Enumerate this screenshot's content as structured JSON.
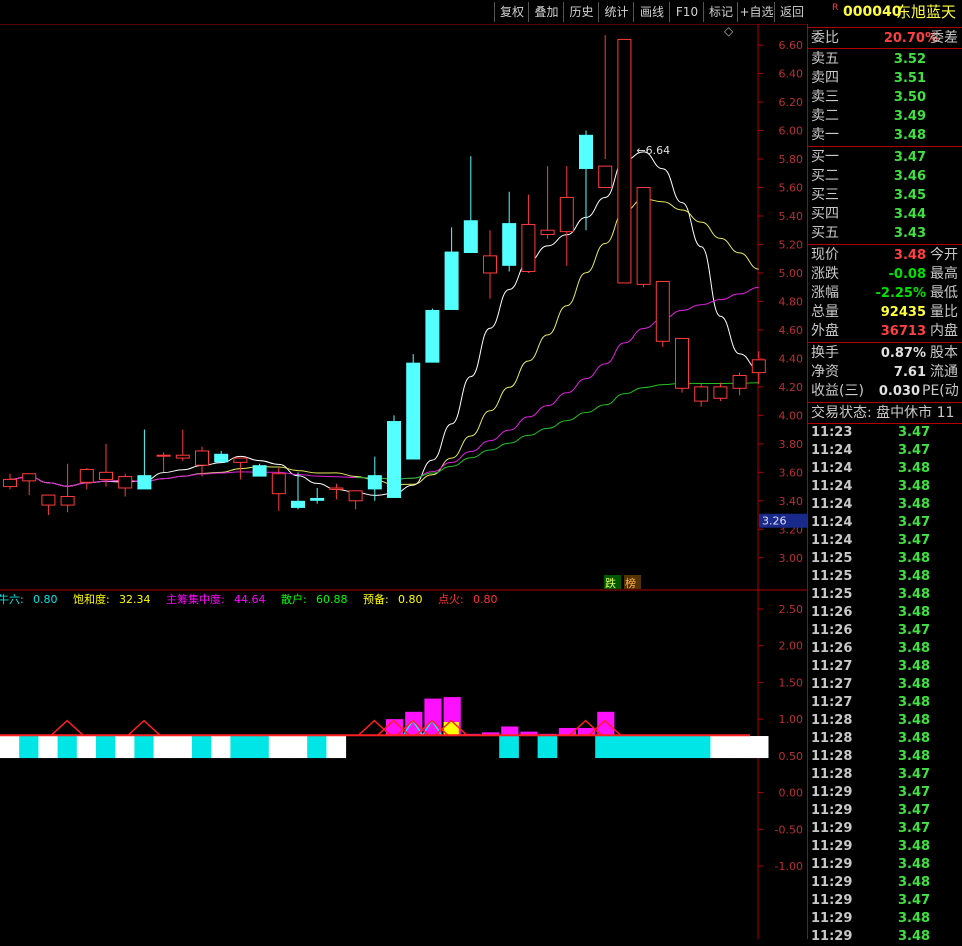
{
  "toolbar": {
    "buttons": [
      "复权",
      "叠加",
      "历史",
      "统计",
      "画线",
      "F10",
      "标记",
      "+自选",
      "返回"
    ],
    "diamond_icon": "diamond-icon"
  },
  "stock": {
    "badge": "R",
    "code": "000040",
    "name": "东旭蓝天"
  },
  "quote": {
    "weibi_label": "委比",
    "weibi_value": "20.70%",
    "weicha_label": "委差",
    "asks": [
      {
        "label": "卖五",
        "price": "3.52"
      },
      {
        "label": "卖四",
        "price": "3.51"
      },
      {
        "label": "卖三",
        "price": "3.50"
      },
      {
        "label": "卖二",
        "price": "3.49"
      },
      {
        "label": "卖一",
        "price": "3.48"
      }
    ],
    "bids": [
      {
        "label": "买一",
        "price": "3.47"
      },
      {
        "label": "买二",
        "price": "3.46"
      },
      {
        "label": "买三",
        "price": "3.45"
      },
      {
        "label": "买四",
        "price": "3.44"
      },
      {
        "label": "买五",
        "price": "3.43"
      }
    ],
    "stats1": [
      {
        "label": "现价",
        "value": "3.48",
        "color": "#ff4040",
        "label2": "今开"
      },
      {
        "label": "涨跌",
        "value": "-0.08",
        "color": "#00e000",
        "label2": "最高"
      },
      {
        "label": "涨幅",
        "value": "-2.25%",
        "color": "#00e000",
        "label2": "最低"
      },
      {
        "label": "总量",
        "value": "92435",
        "color": "#ffff40",
        "label2": "量比"
      },
      {
        "label": "外盘",
        "value": "36713",
        "color": "#ff4040",
        "label2": "内盘"
      }
    ],
    "stats2": [
      {
        "label": "换手",
        "value": "0.87%",
        "color": "#e0e0e0",
        "label2": "股本"
      },
      {
        "label": "净资",
        "value": "7.61",
        "color": "#e0e0e0",
        "label2": "流通"
      },
      {
        "label": "收益(三)",
        "value": "0.030",
        "color": "#e0e0e0",
        "label2": "PE(动"
      }
    ],
    "status_label": "交易状态: 盘中休市 11"
  },
  "ticks": [
    {
      "time": "11:23",
      "price": "3.47"
    },
    {
      "time": "11:24",
      "price": "3.47"
    },
    {
      "time": "11:24",
      "price": "3.48"
    },
    {
      "time": "11:24",
      "price": "3.48"
    },
    {
      "time": "11:24",
      "price": "3.48"
    },
    {
      "time": "11:24",
      "price": "3.47"
    },
    {
      "time": "11:24",
      "price": "3.47"
    },
    {
      "time": "11:25",
      "price": "3.48"
    },
    {
      "time": "11:25",
      "price": "3.48"
    },
    {
      "time": "11:25",
      "price": "3.48"
    },
    {
      "time": "11:26",
      "price": "3.48"
    },
    {
      "time": "11:26",
      "price": "3.47"
    },
    {
      "time": "11:26",
      "price": "3.48"
    },
    {
      "time": "11:27",
      "price": "3.48"
    },
    {
      "time": "11:27",
      "price": "3.48"
    },
    {
      "time": "11:27",
      "price": "3.48"
    },
    {
      "time": "11:28",
      "price": "3.48"
    },
    {
      "time": "11:28",
      "price": "3.48"
    },
    {
      "time": "11:28",
      "price": "3.48"
    },
    {
      "time": "11:28",
      "price": "3.47"
    },
    {
      "time": "11:29",
      "price": "3.47"
    },
    {
      "time": "11:29",
      "price": "3.47"
    },
    {
      "time": "11:29",
      "price": "3.47"
    },
    {
      "time": "11:29",
      "price": "3.48"
    },
    {
      "time": "11:29",
      "price": "3.48"
    },
    {
      "time": "11:29",
      "price": "3.48"
    },
    {
      "time": "11:29",
      "price": "3.47"
    },
    {
      "time": "11:29",
      "price": "3.48"
    },
    {
      "time": "11:29",
      "price": "3.48"
    }
  ],
  "chart_data": [
    {
      "type": "candlestick",
      "y_ticks": [
        "6.60",
        "6.40",
        "6.20",
        "6.00",
        "5.80",
        "5.60",
        "5.40",
        "5.20",
        "5.00",
        "4.80",
        "4.60",
        "4.40",
        "4.20",
        "4.00",
        "3.80",
        "3.60",
        "3.40",
        "3.20",
        "3.00"
      ],
      "ylim": [
        2.9,
        6.72
      ],
      "max_label": "6.64",
      "price_marker": "3.26",
      "markers": [
        "跌",
        "榜"
      ],
      "x": [
        0,
        1,
        2,
        3,
        4,
        5,
        6,
        7,
        8,
        9,
        10,
        11,
        12,
        13,
        14,
        15,
        16,
        17,
        18,
        19,
        20,
        21,
        22,
        23,
        24,
        25,
        26,
        27,
        28,
        29,
        30,
        31,
        32,
        33,
        34,
        35,
        36,
        37,
        38,
        39
      ],
      "open": [
        3.5,
        3.54,
        3.37,
        3.37,
        3.53,
        3.55,
        3.49,
        3.58,
        3.72,
        3.7,
        3.65,
        3.73,
        3.67,
        3.65,
        3.45,
        3.4,
        3.42,
        3.48,
        3.4,
        3.58,
        3.96,
        4.37,
        4.74,
        5.15,
        5.37,
        5.0,
        5.35,
        5.01,
        5.27,
        5.29,
        5.97,
        5.6,
        4.93,
        4.92,
        4.52,
        4.19,
        4.1,
        4.12,
        4.19,
        4.3
      ],
      "high": [
        3.59,
        3.56,
        3.42,
        3.66,
        3.63,
        3.8,
        3.59,
        3.9,
        3.74,
        3.9,
        3.78,
        3.75,
        3.7,
        3.66,
        3.63,
        3.6,
        3.49,
        3.52,
        3.47,
        3.71,
        4.0,
        4.43,
        4.75,
        5.32,
        5.82,
        5.3,
        5.57,
        5.55,
        5.75,
        5.75,
        6.0,
        6.67,
        5.89,
        5.15,
        4.63,
        4.44,
        4.22,
        4.23,
        4.3,
        4.45
      ],
      "low": [
        3.48,
        3.44,
        3.3,
        3.32,
        3.48,
        3.5,
        3.43,
        3.5,
        3.6,
        3.68,
        3.57,
        3.67,
        3.55,
        3.6,
        3.33,
        3.34,
        3.38,
        3.41,
        3.34,
        3.4,
        3.45,
        3.99,
        4.73,
        5.09,
        5.32,
        4.82,
        5.01,
        5.0,
        5.24,
        5.05,
        5.3,
        5.8,
        5.32,
        4.9,
        4.48,
        4.16,
        4.06,
        4.1,
        4.14,
        4.22
      ],
      "close": [
        3.55,
        3.59,
        3.44,
        3.43,
        3.62,
        3.6,
        3.57,
        3.48,
        3.72,
        3.72,
        3.75,
        3.67,
        3.7,
        3.57,
        3.59,
        3.35,
        3.4,
        3.49,
        3.47,
        3.48,
        3.42,
        3.69,
        4.37,
        4.74,
        5.14,
        5.12,
        5.05,
        5.34,
        5.3,
        5.53,
        5.73,
        5.75,
        6.64,
        5.6,
        4.94,
        4.54,
        4.2,
        4.2,
        4.28,
        4.39
      ]
    },
    {
      "type": "bar",
      "y_ticks": [
        "2.50",
        "2.00",
        "1.50",
        "1.00",
        "0.50",
        "0.00",
        "-0.50",
        "-1.00"
      ],
      "ylim": [
        -1.25,
        2.75
      ],
      "legend": [
        {
          "label": "牛六:",
          "value": "0.80",
          "color": "#00e5e5"
        },
        {
          "label": "饱和度:",
          "value": "32.34",
          "color": "#ffff00"
        },
        {
          "label": "主筹集中度:",
          "value": "44.64",
          "color": "#ff00ff"
        },
        {
          "label": "散户:",
          "value": "60.88",
          "color": "#00ff00"
        },
        {
          "label": "预备:",
          "value": "0.80",
          "color": "#ffff00"
        },
        {
          "label": "点火:",
          "value": "0.80",
          "color": "#ff3030"
        }
      ],
      "band": [
        "w",
        "c",
        "w",
        "c",
        "w",
        "c",
        "w",
        "c",
        "w",
        "w",
        "c",
        "w",
        "c",
        "c",
        "w",
        "w",
        "c",
        "w",
        "k",
        "k",
        "k",
        "k",
        "k",
        "k",
        "k",
        "k",
        "c",
        "k",
        "c",
        "k",
        "k",
        "c",
        "c",
        "c",
        "c",
        "c",
        "c",
        "w",
        "w",
        "w"
      ],
      "magenta": [
        0,
        0,
        0,
        0,
        0,
        0,
        0,
        0,
        0,
        0,
        0,
        0,
        0,
        0,
        0,
        0,
        0,
        0,
        0,
        0,
        1.0,
        1.1,
        1.28,
        1.3,
        0.8,
        0.82,
        0.9,
        0.83,
        0.8,
        0.88,
        0.88,
        1.1,
        0,
        0,
        0,
        0,
        0,
        0,
        0,
        0
      ],
      "cyan_cross": [
        0,
        0,
        0,
        0,
        0,
        0,
        0,
        0,
        0,
        0,
        0,
        0,
        0,
        0,
        0,
        0,
        0,
        0,
        0,
        0,
        0,
        1,
        1,
        0,
        0,
        0,
        0,
        0,
        0,
        0,
        0,
        0,
        0,
        0,
        0,
        0,
        0,
        0,
        0,
        0
      ],
      "yellow": [
        0,
        0,
        0,
        0,
        0,
        0,
        0,
        0,
        0,
        0,
        0,
        0,
        0,
        0,
        0,
        0,
        0,
        0,
        0,
        0,
        0,
        0,
        0,
        0.96,
        0,
        0,
        0,
        0,
        0,
        0,
        0,
        0,
        0,
        0,
        0,
        0,
        0,
        0,
        0,
        0
      ],
      "red_hump": [
        0,
        0,
        0,
        0.98,
        0,
        0,
        0,
        0.98,
        0,
        0,
        0,
        0,
        0,
        0,
        0,
        0,
        0,
        0,
        0,
        0.98,
        0.98,
        0.98,
        0.98,
        0.98,
        0,
        0,
        0,
        0,
        0,
        0,
        0.98,
        0.98,
        0,
        0,
        0,
        0,
        0,
        0,
        0,
        0
      ]
    }
  ]
}
